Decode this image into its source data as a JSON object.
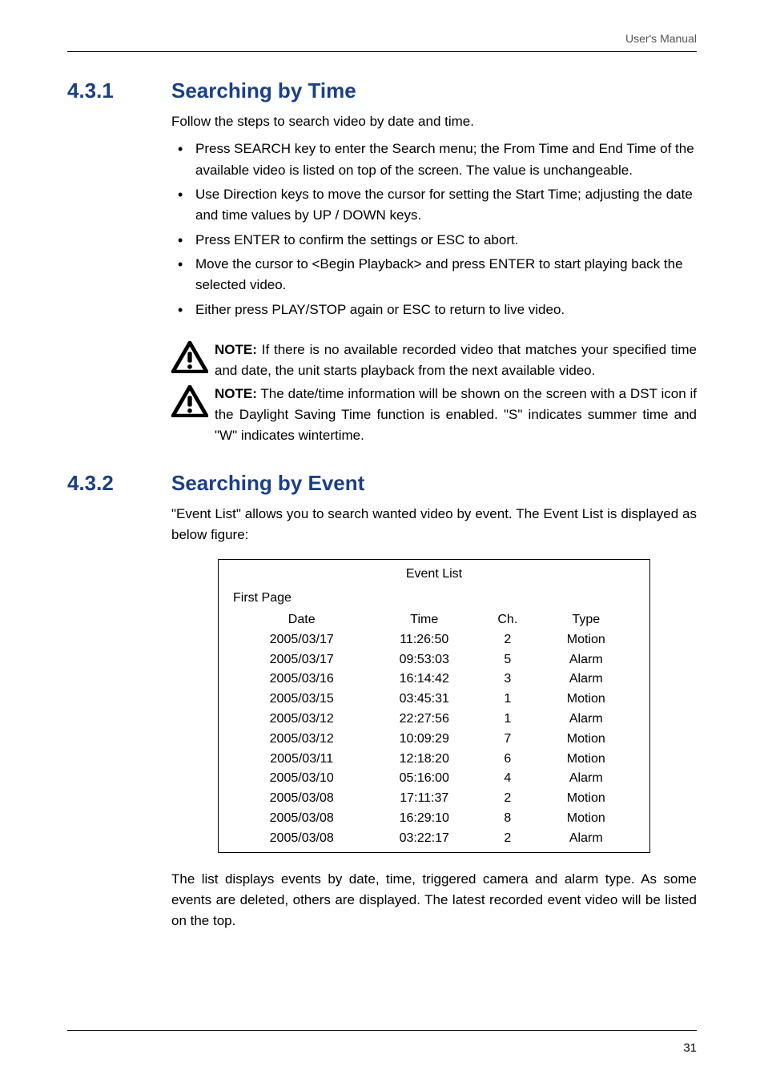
{
  "header": {
    "right": "User's Manual"
  },
  "page_number": "31",
  "section1": {
    "num": "4.3.1",
    "title": "Searching by Time",
    "intro": "Follow the steps to search video by date and time.",
    "bullets": [
      "Press SEARCH key to enter the Search menu; the From Time and End Time of the available video is listed on top of the screen. The value is unchangeable.",
      "Use Direction keys to move the cursor for setting the Start Time; adjusting the date and time values by UP / DOWN keys.",
      "Press ENTER to confirm the settings or ESC to abort.",
      "Move the cursor to <Begin Playback> and press ENTER to start playing back the selected video.",
      "Either press PLAY/STOP again or ESC to return to live video."
    ],
    "notes": [
      {
        "label": "NOTE:",
        "text": " If there is no available recorded video that matches your specified time and date, the unit starts playback from the next available video."
      },
      {
        "label": "NOTE:",
        "text": " The date/time information will be shown on the screen with a DST icon if the Daylight Saving Time function is enabled. \"S\" indicates summer time and \"W\" indicates wintertime."
      }
    ]
  },
  "section2": {
    "num": "4.3.2",
    "title": "Searching by Event",
    "intro": "\"Event List\" allows you to search wanted video by event. The Event List is displayed as below figure:",
    "table": {
      "title": "Event List",
      "first_page": "First Page",
      "headers": {
        "date": "Date",
        "time": "Time",
        "ch": "Ch.",
        "type": "Type"
      },
      "rows": [
        {
          "date": "2005/03/17",
          "time": "11:26:50",
          "ch": "2",
          "type": "Motion"
        },
        {
          "date": "2005/03/17",
          "time": "09:53:03",
          "ch": "5",
          "type": "Alarm"
        },
        {
          "date": "2005/03/16",
          "time": "16:14:42",
          "ch": "3",
          "type": "Alarm"
        },
        {
          "date": "2005/03/15",
          "time": "03:45:31",
          "ch": "1",
          "type": "Motion"
        },
        {
          "date": "2005/03/12",
          "time": "22:27:56",
          "ch": "1",
          "type": "Alarm"
        },
        {
          "date": "2005/03/12",
          "time": "10:09:29",
          "ch": "7",
          "type": "Motion"
        },
        {
          "date": "2005/03/11",
          "time": "12:18:20",
          "ch": "6",
          "type": "Motion"
        },
        {
          "date": "2005/03/10",
          "time": "05:16:00",
          "ch": "4",
          "type": "Alarm"
        },
        {
          "date": "2005/03/08",
          "time": "17:11:37",
          "ch": "2",
          "type": "Motion"
        },
        {
          "date": "2005/03/08",
          "time": "16:29:10",
          "ch": "8",
          "type": "Motion"
        },
        {
          "date": "2005/03/08",
          "time": "03:22:17",
          "ch": "2",
          "type": "Alarm"
        }
      ]
    },
    "after": "The list displays events by date, time, triggered camera and alarm type. As some events are deleted, others are displayed. The latest recorded event video will be listed on the top."
  }
}
